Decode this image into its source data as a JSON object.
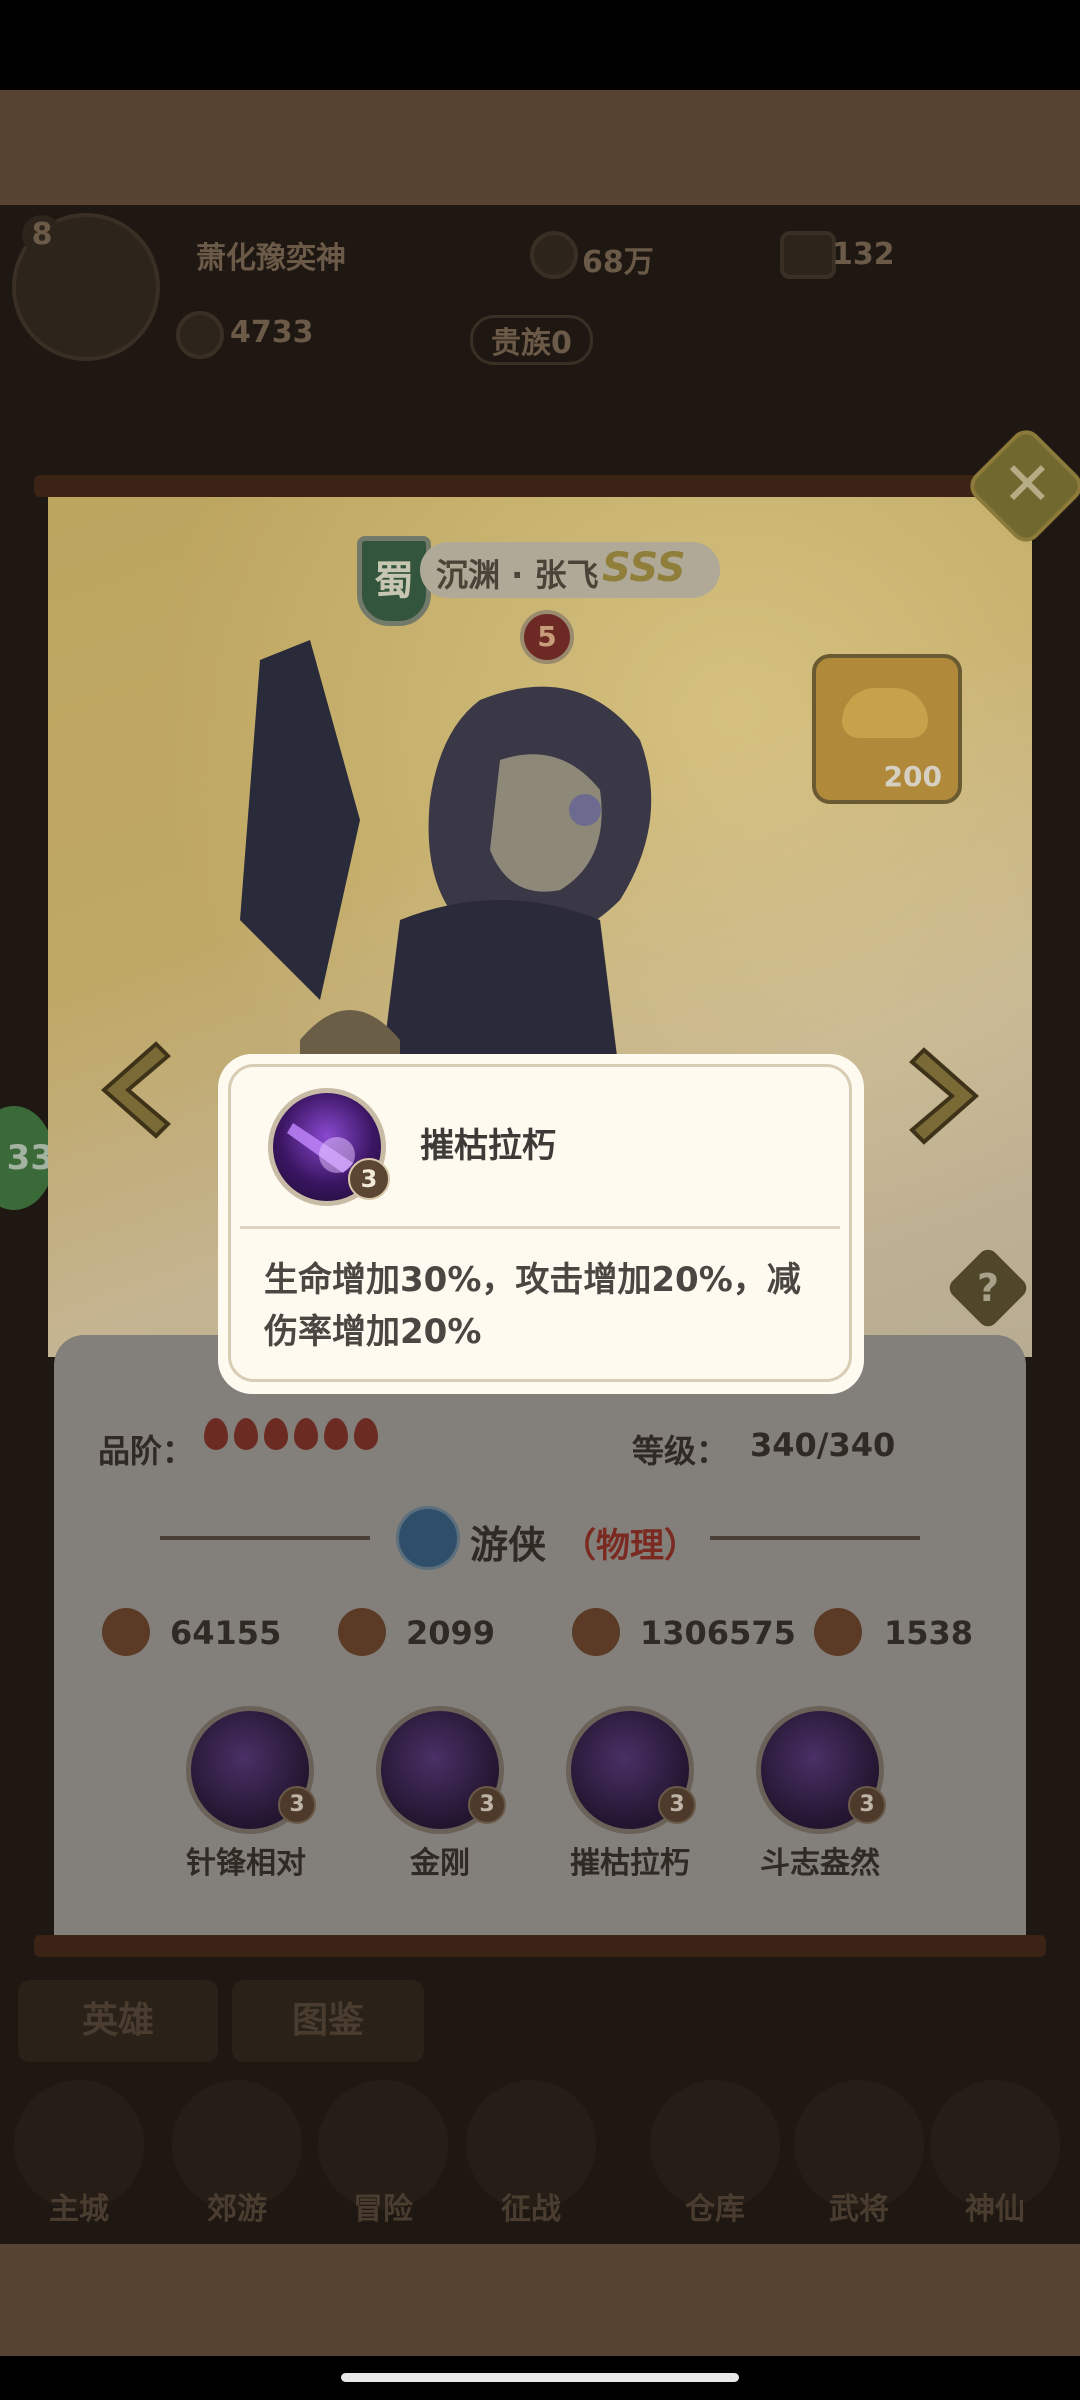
{
  "hud": {
    "player_level": "8",
    "player_name": "萧化豫奕神",
    "power": "68万",
    "gold": "132",
    "food": "4733",
    "vip": "贵族0"
  },
  "hero": {
    "faction": "蜀",
    "name": "沉渊 · 张飞",
    "rank": "SSS",
    "stars": "5",
    "reward_count": "200"
  },
  "info": {
    "grade_label": "品阶：",
    "grade_pips": 6,
    "level_label": "等级：",
    "level_value": "340/340",
    "class_name": "游侠",
    "class_type": "（物理）",
    "stats": {
      "attack": "64155",
      "defense": "2099",
      "hp": "1306575",
      "speed": "1538"
    }
  },
  "skills": [
    {
      "name": "针锋相对",
      "level": "3"
    },
    {
      "name": "金刚",
      "level": "3"
    },
    {
      "name": "摧枯拉朽",
      "level": "3"
    },
    {
      "name": "斗志盎然",
      "level": "3"
    }
  ],
  "side_badge": "33",
  "menu": {
    "tabs": [
      "英雄",
      "图鉴"
    ],
    "buttons": [
      "主城",
      "郊游",
      "冒险",
      "征战",
      "仓库",
      "武将",
      "神仙"
    ]
  },
  "popup": {
    "skill_name": "摧枯拉朽",
    "skill_level": "3",
    "description": "生命增加30%，攻击增加20%，减伤率增加20%"
  },
  "colors": {
    "band": "#564332",
    "popup_bg": "#fefaf0",
    "accent": "#6c2b22"
  }
}
